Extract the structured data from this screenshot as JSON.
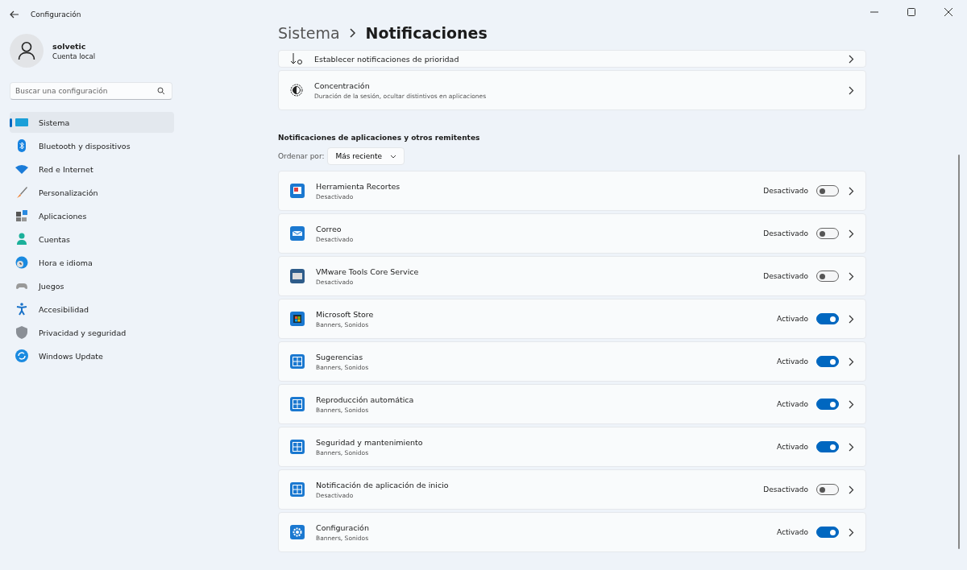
{
  "window": {
    "title": "Configuración"
  },
  "user": {
    "name": "solvetic",
    "account": "Cuenta local"
  },
  "search": {
    "placeholder": "Buscar una configuración"
  },
  "sidebar": {
    "items": [
      {
        "label": "Sistema",
        "kind": "system",
        "selected": true
      },
      {
        "label": "Bluetooth y dispositivos",
        "kind": "bluetooth",
        "selected": false
      },
      {
        "label": "Red e Internet",
        "kind": "network",
        "selected": false
      },
      {
        "label": "Personalización",
        "kind": "brush",
        "selected": false
      },
      {
        "label": "Aplicaciones",
        "kind": "apps",
        "selected": false
      },
      {
        "label": "Cuentas",
        "kind": "person",
        "selected": false
      },
      {
        "label": "Hora e idioma",
        "kind": "clock",
        "selected": false
      },
      {
        "label": "Juegos",
        "kind": "gamepad",
        "selected": false
      },
      {
        "label": "Accesibilidad",
        "kind": "accessibility",
        "selected": false
      },
      {
        "label": "Privacidad y seguridad",
        "kind": "shield",
        "selected": false
      },
      {
        "label": "Windows Update",
        "kind": "update",
        "selected": false
      }
    ]
  },
  "breadcrumb": {
    "parent": "Sistema",
    "current": "Notificaciones"
  },
  "settings": [
    {
      "title": "Establecer notificaciones de prioridad",
      "kind": "priority"
    },
    {
      "title": "Concentración",
      "subtitle": "Duración de la sesión, ocultar distintivos en aplicaciones",
      "kind": "focus"
    }
  ],
  "section_title": "Notificaciones de aplicaciones y otros remitentes",
  "sort": {
    "label": "Ordenar por:",
    "value": "Más reciente"
  },
  "apps": [
    {
      "name": "Herramienta Recortes",
      "detail": "Desactivado",
      "status": "Desactivado",
      "on": false,
      "kind": "snip"
    },
    {
      "name": "Correo",
      "detail": "Desactivado",
      "status": "Desactivado",
      "on": false,
      "kind": "mail"
    },
    {
      "name": "VMware Tools Core Service",
      "detail": "Desactivado",
      "status": "Desactivado",
      "on": false,
      "kind": "vm"
    },
    {
      "name": "Microsoft Store",
      "detail": "Banners, Sonidos",
      "status": "Activado",
      "on": true,
      "kind": "store"
    },
    {
      "name": "Sugerencias",
      "detail": "Banners, Sonidos",
      "status": "Activado",
      "on": true,
      "kind": "generic"
    },
    {
      "name": "Reproducción automática",
      "detail": "Banners, Sonidos",
      "status": "Activado",
      "on": true,
      "kind": "generic"
    },
    {
      "name": "Seguridad y mantenimiento",
      "detail": "Banners, Sonidos",
      "status": "Activado",
      "on": true,
      "kind": "generic"
    },
    {
      "name": "Notificación de aplicación de inicio",
      "detail": "Desactivado",
      "status": "Desactivado",
      "on": false,
      "kind": "generic"
    },
    {
      "name": "Configuración",
      "detail": "Banners, Sonidos",
      "status": "Activado",
      "on": true,
      "kind": "gear"
    }
  ]
}
